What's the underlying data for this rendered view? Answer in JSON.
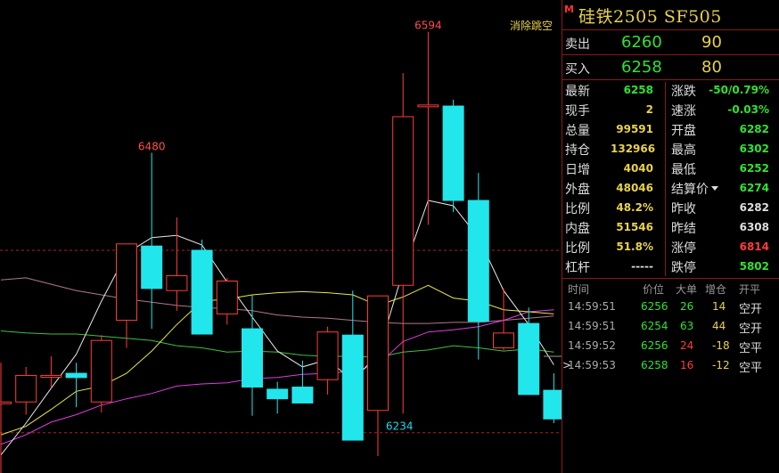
{
  "chart_data": {
    "type": "candlestick",
    "ylim": [
      6178,
      6624
    ],
    "candles": [
      {
        "open": 6245,
        "high": 6282,
        "low": 6168,
        "close": 6245,
        "dir": "up"
      },
      {
        "open": 6245,
        "high": 6278,
        "low": 6233,
        "close": 6270,
        "dir": "up"
      },
      {
        "open": 6270,
        "high": 6288,
        "low": 6258,
        "close": 6270,
        "dir": "up"
      },
      {
        "open": 6268,
        "high": 6282,
        "low": 6240,
        "close": 6272,
        "dir": "down"
      },
      {
        "open": 6245,
        "high": 6308,
        "low": 6235,
        "close": 6303,
        "dir": "up"
      },
      {
        "open": 6322,
        "high": 6394,
        "low": 6296,
        "close": 6394,
        "dir": "up"
      },
      {
        "open": 6392,
        "high": 6480,
        "low": 6314,
        "close": 6352,
        "dir": "down"
      },
      {
        "open": 6364,
        "high": 6419,
        "low": 6331,
        "close": 6350,
        "dir": "up"
      },
      {
        "open": 6388,
        "high": 6398,
        "low": 6309,
        "close": 6309,
        "dir": "down"
      },
      {
        "open": 6328,
        "high": 6362,
        "low": 6318,
        "close": 6359,
        "dir": "up"
      },
      {
        "open": 6314,
        "high": 6346,
        "low": 6232,
        "close": 6259,
        "dir": "down"
      },
      {
        "open": 6257,
        "high": 6264,
        "low": 6234,
        "close": 6248,
        "dir": "down"
      },
      {
        "open": 6259,
        "high": 6284,
        "low": 6244,
        "close": 6244,
        "dir": "down"
      },
      {
        "open": 6266,
        "high": 6316,
        "low": 6252,
        "close": 6311,
        "dir": "up"
      },
      {
        "open": 6308,
        "high": 6350,
        "low": 6209,
        "close": 6209,
        "dir": "down"
      },
      {
        "open": 6237,
        "high": 6339,
        "low": 6194,
        "close": 6345,
        "dir": "up"
      },
      {
        "open": 6355,
        "high": 6555,
        "low": 6234,
        "close": 6514,
        "dir": "up"
      },
      {
        "open": 6525,
        "high": 6594,
        "low": 6412,
        "close": 6525,
        "dir": "up"
      },
      {
        "open": 6524,
        "high": 6530,
        "low": 6424,
        "close": 6435,
        "dir": "down"
      },
      {
        "open": 6435,
        "high": 6461,
        "low": 6285,
        "close": 6321,
        "dir": "down"
      },
      {
        "open": 6310,
        "high": 6352,
        "low": 6294,
        "close": 6296,
        "dir": "up"
      },
      {
        "open": 6319,
        "high": 6334,
        "low": 6252,
        "close": 6252,
        "dir": "down"
      },
      {
        "open": 6256,
        "high": 6272,
        "low": 6225,
        "close": 6229,
        "dir": "down"
      }
    ],
    "ma_white": [
      6195,
      6225,
      6258,
      6290,
      6340,
      6385,
      6400,
      6402,
      6393,
      6358,
      6325,
      6293,
      6278,
      6285,
      6265,
      6290,
      6368,
      6435,
      6430,
      6400,
      6350,
      6318,
      6280
    ],
    "ma_yellow": [
      6214,
      6222,
      6238,
      6255,
      6260,
      6272,
      6293,
      6318,
      6340,
      6342,
      6346,
      6348,
      6349,
      6348,
      6346,
      6336,
      6344,
      6355,
      6343,
      6340,
      6332,
      6330,
      6328
    ],
    "ma_magenta": [
      6205,
      6214,
      6226,
      6233,
      6242,
      6248,
      6253,
      6260,
      6262,
      6263,
      6267,
      6268,
      6271,
      6272,
      6274,
      6280,
      6302,
      6311,
      6313,
      6316,
      6322,
      6330,
      6332
    ],
    "ma_green": [
      6312,
      6310,
      6309,
      6309,
      6307,
      6305,
      6303,
      6298,
      6296,
      6292,
      6293,
      6292,
      6289,
      6288,
      6288,
      6287,
      6292,
      6294,
      6298,
      6296,
      6293,
      6295,
      6292
    ],
    "ma_pink": [
      6360,
      6362,
      6356,
      6350,
      6346,
      6342,
      6339,
      6336,
      6334,
      6333,
      6331,
      6327,
      6325,
      6324,
      6322,
      6320,
      6319,
      6319,
      6320,
      6320,
      6322,
      6324,
      6326
    ],
    "ref_lines": [
      6388,
      6216
    ],
    "annotations": [
      {
        "label": "6480",
        "value": 6480,
        "index": 6,
        "color": "#ff4d4d"
      },
      {
        "label": "6594",
        "value": 6594,
        "index": 17,
        "color": "#ff4d4d"
      },
      {
        "label": "6234",
        "value": 6234,
        "index": 16,
        "color": "#21d8e8"
      }
    ],
    "corner_label": "消除跳空"
  },
  "panel": {
    "badge": "M",
    "title": "硅铁2505  SF505",
    "sell": {
      "label": "卖出",
      "price": "6260",
      "volume": "90"
    },
    "buy": {
      "label": "买入",
      "price": "6258",
      "volume": "80"
    },
    "stats": [
      {
        "l": "最新",
        "v": "6258",
        "vc": "c-green",
        "l2": "涨跌",
        "v2": "-50/0.79%",
        "v2c": "c-green"
      },
      {
        "l": "现手",
        "v": "2",
        "vc": "c-yellow",
        "l2": "速涨",
        "v2": "-0.03%",
        "v2c": "c-green"
      },
      {
        "l": "总量",
        "v": "99591",
        "vc": "c-yellow",
        "l2": "开盘",
        "v2": "6282",
        "v2c": "c-green"
      },
      {
        "l": "持仓",
        "v": "132966",
        "vc": "c-yellow",
        "l2": "最高",
        "v2": "6302",
        "v2c": "c-green"
      },
      {
        "l": "日增",
        "v": "4040",
        "vc": "c-yellow",
        "l2": "最低",
        "v2": "6252",
        "v2c": "c-green"
      },
      {
        "l": "外盘",
        "v": "48046",
        "vc": "c-yellow",
        "l2": "结算价",
        "v2": "6274",
        "v2c": "c-green"
      },
      {
        "l": "比例",
        "v": "48.2%",
        "vc": "c-yellow",
        "l2": "昨收",
        "v2": "6282",
        "v2c": "c-white"
      },
      {
        "l": "内盘",
        "v": "51546",
        "vc": "c-yellow",
        "l2": "昨结",
        "v2": "6308",
        "v2c": "c-white"
      },
      {
        "l": "比例",
        "v": "51.8%",
        "vc": "c-yellow",
        "l2": "涨停",
        "v2": "6814",
        "v2c": "c-red"
      },
      {
        "l": "杠杆",
        "v": "-----",
        "vc": "c-white",
        "l2": "跌停",
        "v2": "5802",
        "v2c": "c-green"
      }
    ],
    "tape_headers": {
      "time": "时间",
      "price": "价位",
      "big": "大单",
      "chg": "增仓",
      "type": "开平"
    },
    "tape": [
      {
        "time": "14:59:51",
        "price": "6256",
        "big": "26",
        "bigc": "c-green",
        "chg": "14",
        "type": "空开",
        "cur": ""
      },
      {
        "time": "14:59:51",
        "price": "6254",
        "big": "63",
        "bigc": "c-green",
        "chg": "44",
        "type": "空开",
        "cur": ""
      },
      {
        "time": "14:59:52",
        "price": "6256",
        "big": "24",
        "bigc": "c-red",
        "chg": "-18",
        "type": "空平",
        "cur": ""
      },
      {
        "time": "14:59:53",
        "price": "6258",
        "big": "16",
        "bigc": "c-red",
        "chg": "-12",
        "type": "空平",
        "cur": ">"
      }
    ]
  }
}
